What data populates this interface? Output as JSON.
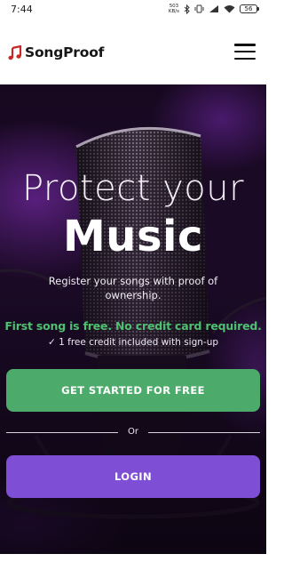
{
  "status_bar": {
    "time": "7:44",
    "speed_value": "503",
    "speed_unit": "KB/s",
    "battery": "56"
  },
  "header": {
    "brand_name": "SongProof",
    "logo_icon": "music-note-icon",
    "menu_icon": "hamburger-menu-icon",
    "brand_color": "#c62828"
  },
  "hero": {
    "title_line1": "Protect your",
    "title_line2": "Music",
    "subtitle": "Register your songs with proof of ownership.",
    "free_text": "First song is free. No credit card required.",
    "credit_check": "✓",
    "credit_text": "1 free credit included with sign-up",
    "background_image": "studio-microphone"
  },
  "actions": {
    "get_started_label": "GET STARTED FOR FREE",
    "divider_label": "Or",
    "login_label": "LOGIN",
    "get_started_color": "#4caa6b",
    "login_color": "#7e4ed4"
  }
}
